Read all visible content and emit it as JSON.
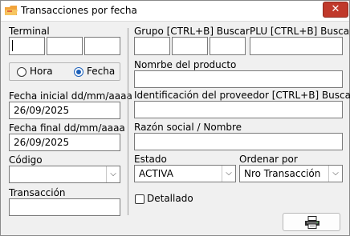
{
  "window": {
    "title": "Transacciones por fecha",
    "close_glyph": "✕"
  },
  "left": {
    "terminal_label": "Terminal",
    "terminal_values": [
      "",
      "",
      ""
    ],
    "radio_hora_label": "Hora",
    "radio_fecha_label": "Fecha",
    "selected_radio": "Fecha",
    "fecha_inicial_label": "Fecha inicial dd/mm/aaaa",
    "fecha_inicial_value": "26/09/2025",
    "fecha_final_label": "Fecha final dd/mm/aaaa",
    "fecha_final_value": "26/09/2025",
    "codigo_label": "Código",
    "codigo_value": "",
    "transaccion_label": "Transacción",
    "transaccion_value": ""
  },
  "right": {
    "grupo_label": "Grupo [CTRL+B] Buscar",
    "grupo_values": [
      "",
      "",
      ""
    ],
    "plu_label": "PLU [CTRL+B] Buscar",
    "plu_value": "",
    "producto_label": "Nomrbe del producto",
    "producto_value": "",
    "proveedor_label": "Identificación del proveedor [CTRL+B] Buscar",
    "proveedor_value": "",
    "razon_label": "Razón social / Nombre",
    "razon_value": "",
    "estado_label": "Estado",
    "estado_value": "ACTIVA",
    "ordenar_label": "Ordenar por",
    "ordenar_value": "Nro Transacción",
    "detallado_label": "Detallado",
    "detallado_checked": false
  },
  "icons": {
    "app": "folder-icon",
    "print": "printer-icon",
    "dropdown": "chevron-down-icon"
  }
}
